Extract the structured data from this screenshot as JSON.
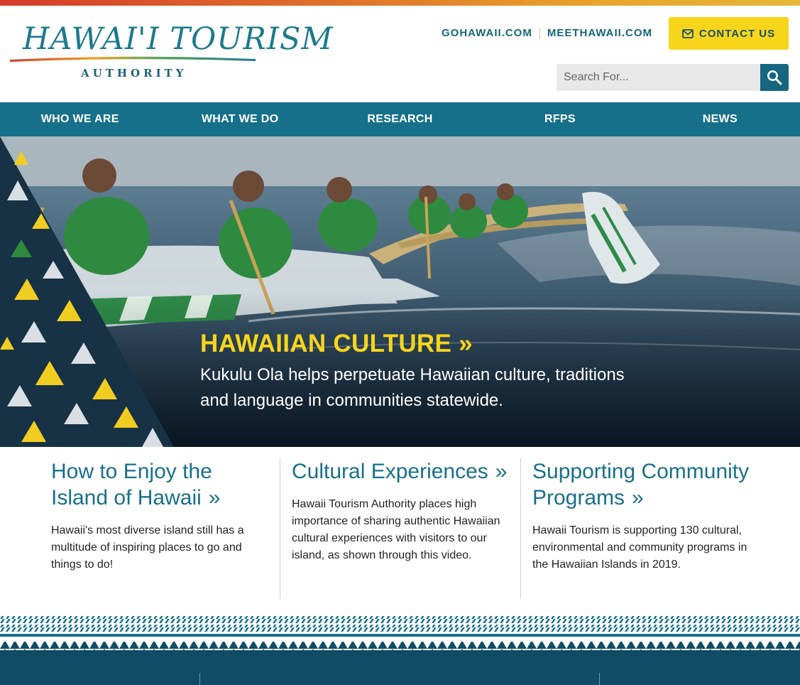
{
  "brand": {
    "logo_text": "HAWAI'I TOURISM",
    "logo_sub": "AUTHORITY"
  },
  "header": {
    "links": [
      "GOHAWAII.COM",
      "MEETHAWAII.COM"
    ],
    "contact_label": "CONTACT US",
    "search_placeholder": "Search For..."
  },
  "nav": {
    "items": [
      "WHO WE ARE",
      "WHAT WE DO",
      "RESEARCH",
      "RFPS",
      "NEWS"
    ]
  },
  "hero": {
    "title": "HAWAIIAN CULTURE »",
    "text": "Kukulu Ola helps perpetuate Hawaiian culture, traditions and language in communities statewide."
  },
  "cards": [
    {
      "title": "How to Enjoy the Island of Hawaii",
      "arrow": "»",
      "text": "Hawaii's most diverse island still has a multitude of inspiring places to go and things to do!"
    },
    {
      "title": "Cultural Experiences",
      "arrow": "»",
      "text": "Hawaii Tourism Authority places high importance of sharing authentic Hawaiian cultural experiences with visitors to our island, as shown through this video."
    },
    {
      "title": "Supporting Community Programs",
      "arrow": "»",
      "text": "Hawaii Tourism is supporting 130 cultural, environmental and community programs in the Hawaiian Islands in 2019."
    }
  ],
  "colors": {
    "brand_teal": "#17708a",
    "accent_yellow": "#f7d51b",
    "footer_navy": "#0f4d66"
  },
  "icons": {
    "contact": "envelope-icon",
    "search": "search-icon"
  }
}
